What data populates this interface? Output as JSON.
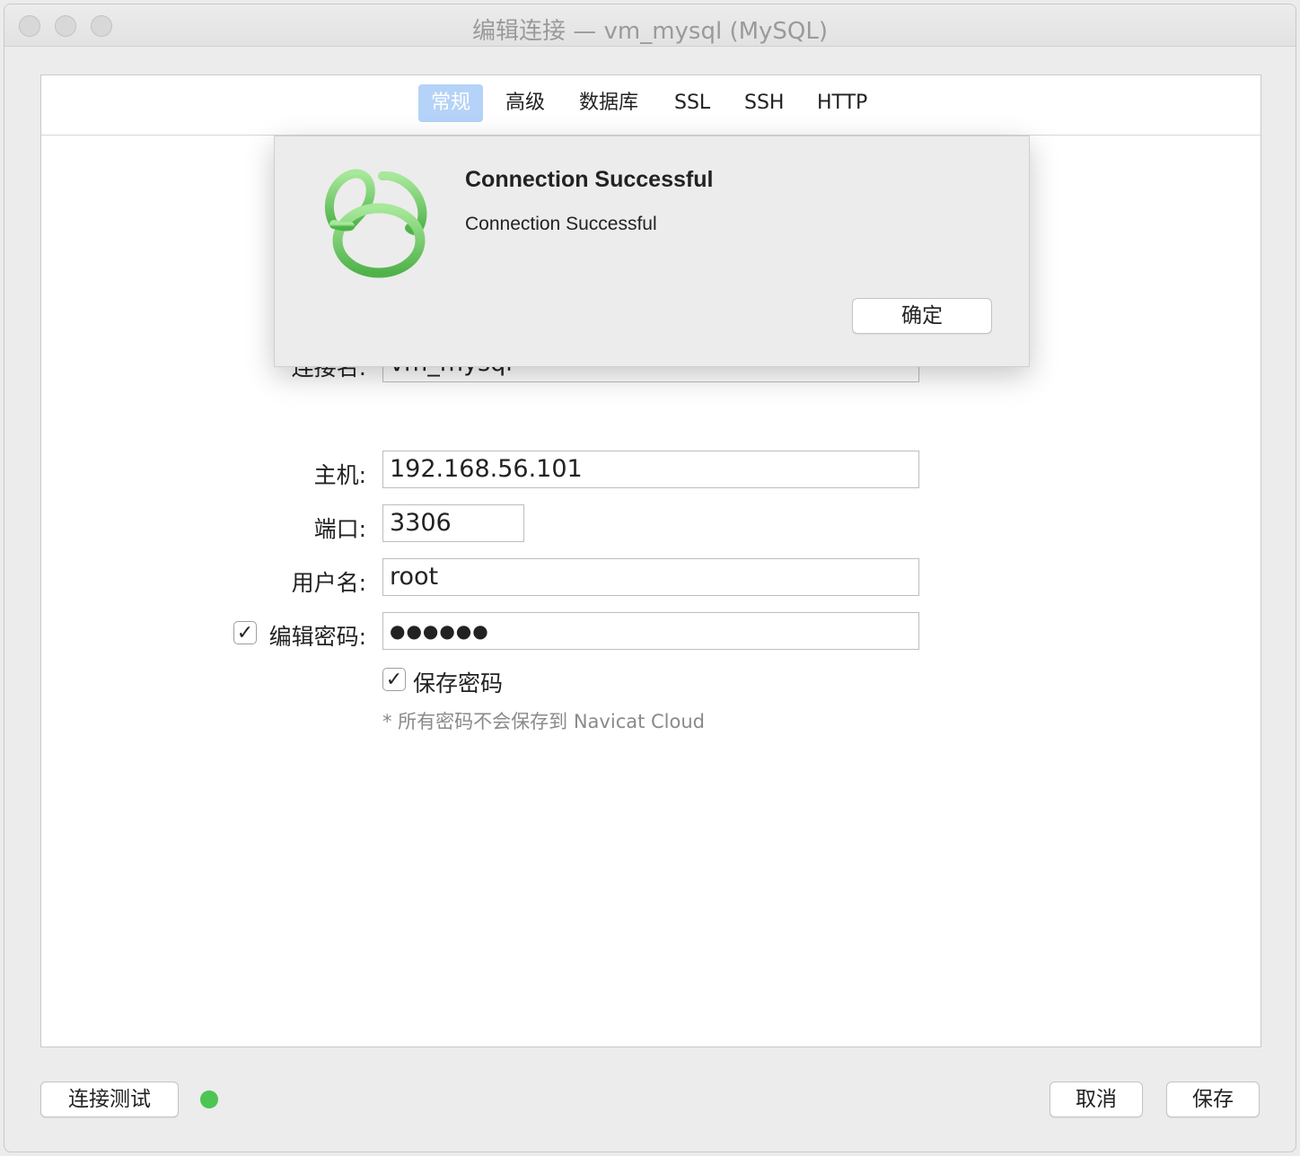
{
  "window": {
    "title": "编辑连接 — vm_mysql (MySQL)"
  },
  "tabs": [
    {
      "label": "常规",
      "active": true
    },
    {
      "label": "高级",
      "active": false
    },
    {
      "label": "数据库",
      "active": false
    },
    {
      "label": "SSL",
      "active": false
    },
    {
      "label": "SSH",
      "active": false
    },
    {
      "label": "HTTP",
      "active": false
    }
  ],
  "form": {
    "connection_name": {
      "label": "连接名:",
      "value": "vm_mysql"
    },
    "host": {
      "label": "主机:",
      "value": "192.168.56.101"
    },
    "port": {
      "label": "端口:",
      "value": "3306"
    },
    "username": {
      "label": "用户名:",
      "value": "root"
    },
    "password": {
      "label": "编辑密码:",
      "value": "●●●●●●",
      "edit_checked": true
    },
    "save_password": {
      "label": "保存密码",
      "checked": true
    },
    "note": "* 所有密码不会保存到 Navicat Cloud"
  },
  "footer": {
    "test_button": "连接测试",
    "cancel_button": "取消",
    "save_button": "保存",
    "status_color": "#4cc552"
  },
  "dialog": {
    "title": "Connection Successful",
    "message": "Connection Successful",
    "ok_button": "确定",
    "icon": "navicat-logo-icon",
    "accent": "#5cc95a"
  },
  "checkmark": "✓"
}
